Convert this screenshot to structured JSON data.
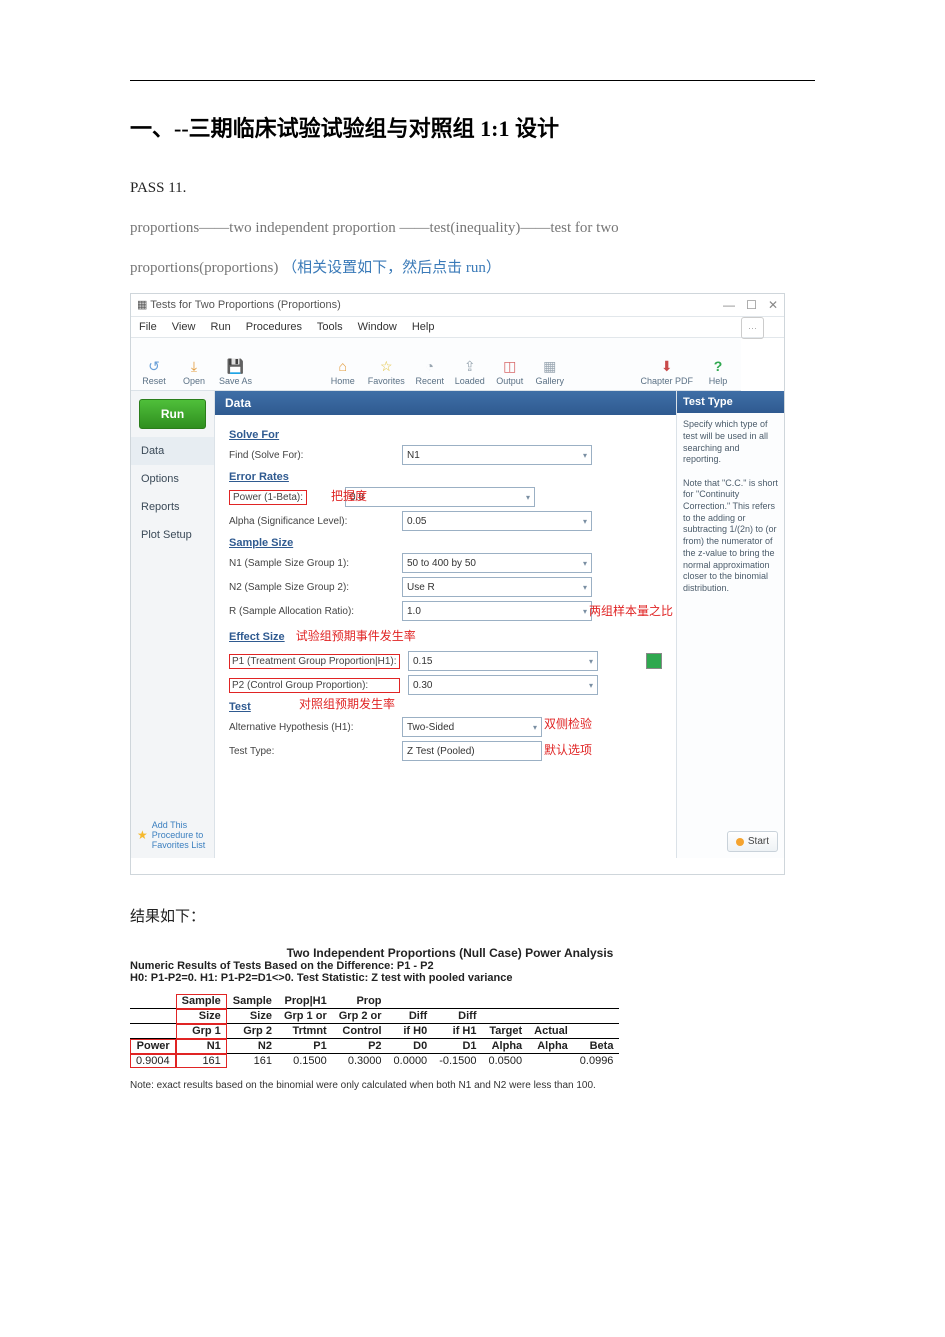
{
  "doc": {
    "heading": "一、--三期临床试验试验组与对照组 1:1 设计",
    "line1": "PASS  11.",
    "line2a": "proportions——two  independent   proportion ——test(inequality)——test  for  two",
    "line2b": "proportions(proportions)",
    "line2c": "（相关设置如下，然后点击 run）",
    "after_results_label": "结果如下："
  },
  "window": {
    "title": "Tests for Two Proportions (Proportions)",
    "menu": [
      "File",
      "View",
      "Run",
      "Procedures",
      "Tools",
      "Window",
      "Help"
    ],
    "toolbar_left": [
      {
        "icon": "↺",
        "label": "Reset"
      },
      {
        "icon": "⤓",
        "label": "Open"
      },
      {
        "icon": "💾",
        "label": "Save As"
      }
    ],
    "toolbar_mid": [
      {
        "icon": "⌂",
        "label": "Home"
      },
      {
        "icon": "☆",
        "label": "Favorites"
      },
      {
        "icon": "◔",
        "label": "Recent"
      },
      {
        "icon": "⇪",
        "label": "Loaded"
      },
      {
        "icon": "◫",
        "label": "Output"
      },
      {
        "icon": "▦",
        "label": "Gallery"
      }
    ],
    "toolbar_right": [
      {
        "icon": "⬇",
        "label": "Chapter PDF"
      },
      {
        "icon": "?",
        "label": "Help"
      }
    ],
    "run_button": "Run",
    "nav": [
      "Data",
      "Options",
      "Reports",
      "Plot Setup"
    ],
    "nav_footer": "Add This Procedure to Favorites List",
    "form_header": "Data",
    "sections": {
      "solve_for": "Solve For",
      "error_rates": "Error Rates",
      "sample_size": "Sample Size",
      "effect_size": "Effect Size",
      "test": "Test"
    },
    "fields": {
      "find_label": "Find (Solve For):",
      "find_value": "N1",
      "power_label": "Power (1-Beta):",
      "power_value": "0.9",
      "alpha_label": "Alpha (Significance Level):",
      "alpha_value": "0.05",
      "n1_label": "N1 (Sample Size Group 1):",
      "n1_value": "50 to 400 by 50",
      "n2_label": "N2 (Sample Size Group 2):",
      "n2_value": "Use R",
      "r_label": "R (Sample Allocation Ratio):",
      "r_value": "1.0",
      "p1_label": "P1 (Treatment Group Proportion|H1):",
      "p1_value": "0.15",
      "p2_label": "P2 (Control Group Proportion):",
      "p2_value": "0.30",
      "h1_label": "Alternative Hypothesis (H1):",
      "h1_value": "Two-Sided",
      "tt_label": "Test Type:",
      "tt_value": "Z Test (Pooled)"
    },
    "annotations": {
      "power": "把握度",
      "effect_title": "试验组预期事件发生率",
      "p2": "对照组预期发生率",
      "r": "两组样本量之比",
      "h1": "双侧检验",
      "tt": "默认选项"
    },
    "helppane": {
      "title": "Test Type",
      "text": "Specify which type of test will be used in all searching and reporting.\n\nNote that \"C.C.\" is short for \"Continuity Correction.\" This refers to the adding or subtracting 1/(2n) to (or from) the numerator of the z-value to bring the normal approximation closer to the binomial distribution."
    },
    "start_button": "Start"
  },
  "results": {
    "title": "Two Independent Proportions (Null Case) Power Analysis",
    "subtitle": "Numeric Results of Tests Based on the Difference: P1 - P2",
    "hypothesis": "H0: P1-P2=0. H1: P1-P2=D1<>0. Test Statistic: Z test with pooled variance",
    "headers_row1": [
      "",
      "Sample",
      "Sample",
      "Prop|H1",
      "Prop",
      "",
      "",
      "",
      "",
      ""
    ],
    "headers_row2": [
      "",
      "Size",
      "Size",
      "Grp 1 or",
      "Grp 2 or",
      "Diff",
      "Diff",
      "",
      "",
      ""
    ],
    "headers_row3": [
      "",
      "Grp 1",
      "Grp 2",
      "Trtmnt",
      "Control",
      "if H0",
      "if H1",
      "Target",
      "Actual",
      ""
    ],
    "headers_row4": [
      "Power",
      "N1",
      "N2",
      "P1",
      "P2",
      "D0",
      "D1",
      "Alpha",
      "Alpha",
      "Beta"
    ],
    "row": [
      "0.9004",
      "161",
      "161",
      "0.1500",
      "0.3000",
      "0.0000",
      "-0.1500",
      "0.0500",
      "",
      "0.0996"
    ],
    "note": "Note: exact results based on the binomial were only calculated when both N1 and N2 were less than 100."
  },
  "chart_data": {
    "type": "table",
    "title": "Two Independent Proportions (Null Case) Power Analysis",
    "columns": [
      "Power",
      "N1",
      "N2",
      "P1",
      "P2",
      "D0",
      "D1",
      "Target Alpha",
      "Actual Alpha",
      "Beta"
    ],
    "rows": [
      [
        0.9004,
        161,
        161,
        0.15,
        0.3,
        0.0,
        -0.15,
        0.05,
        null,
        0.0996
      ]
    ]
  }
}
